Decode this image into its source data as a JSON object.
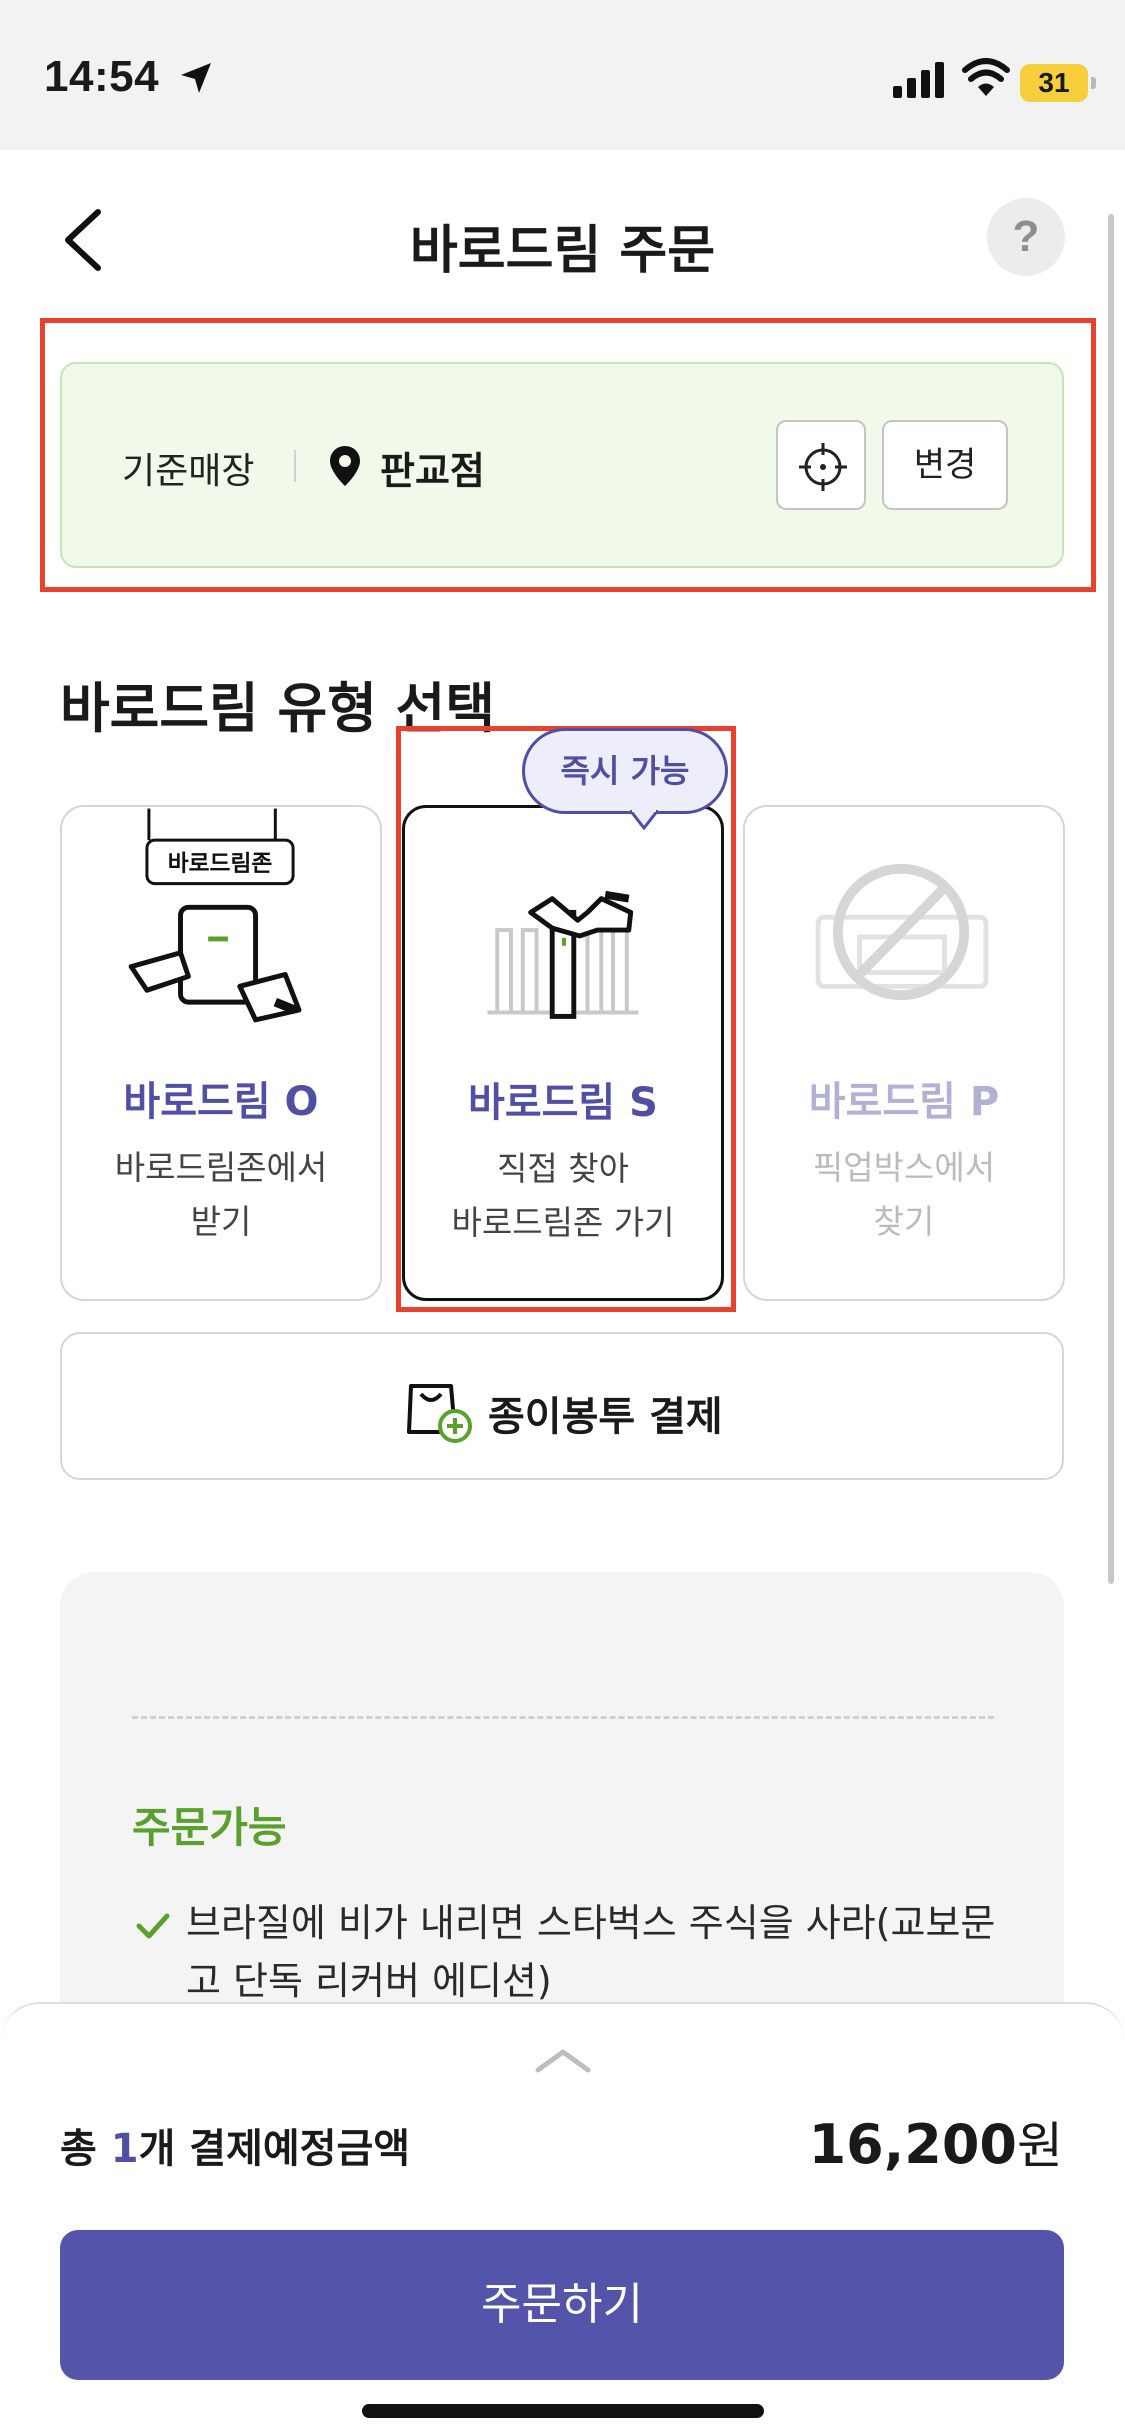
{
  "status_bar": {
    "time": "14:54",
    "battery": "31"
  },
  "header": {
    "title": "바로드림 주문",
    "help": "?"
  },
  "store": {
    "label": "기준매장",
    "name": "판교점",
    "change_label": "변경"
  },
  "type_section": {
    "title": "바로드림 유형 선택",
    "tooltip": "즉시 가능",
    "zone_sign": "바로드림존",
    "cards": [
      {
        "title": "바로드림 O",
        "desc_line1": "바로드림존에서",
        "desc_line2": "받기",
        "state": "available"
      },
      {
        "title": "바로드림 S",
        "desc_line1": "직접 찾아",
        "desc_line2": "바로드림존 가기",
        "state": "selected"
      },
      {
        "title": "바로드림 P",
        "desc_line1": "픽업박스에서",
        "desc_line2": "찾기",
        "state": "disabled"
      }
    ]
  },
  "paper_bag": {
    "label": "종이봉투 결제"
  },
  "availability": {
    "status": "주문가능",
    "item": "브라질에 비가 내리면 스타벅스 주식을 사라(교보문고 단독 리커버 에디션)"
  },
  "summary": {
    "prefix": "총 ",
    "count": "1",
    "suffix": "개 결제예정금액",
    "amount": "16,200",
    "currency": "원"
  },
  "order_button": "주문하기",
  "colors": {
    "accent": "#5354aa",
    "success": "#5aa02c",
    "highlight": "#e8412e",
    "store_bg": "#f1faea"
  }
}
